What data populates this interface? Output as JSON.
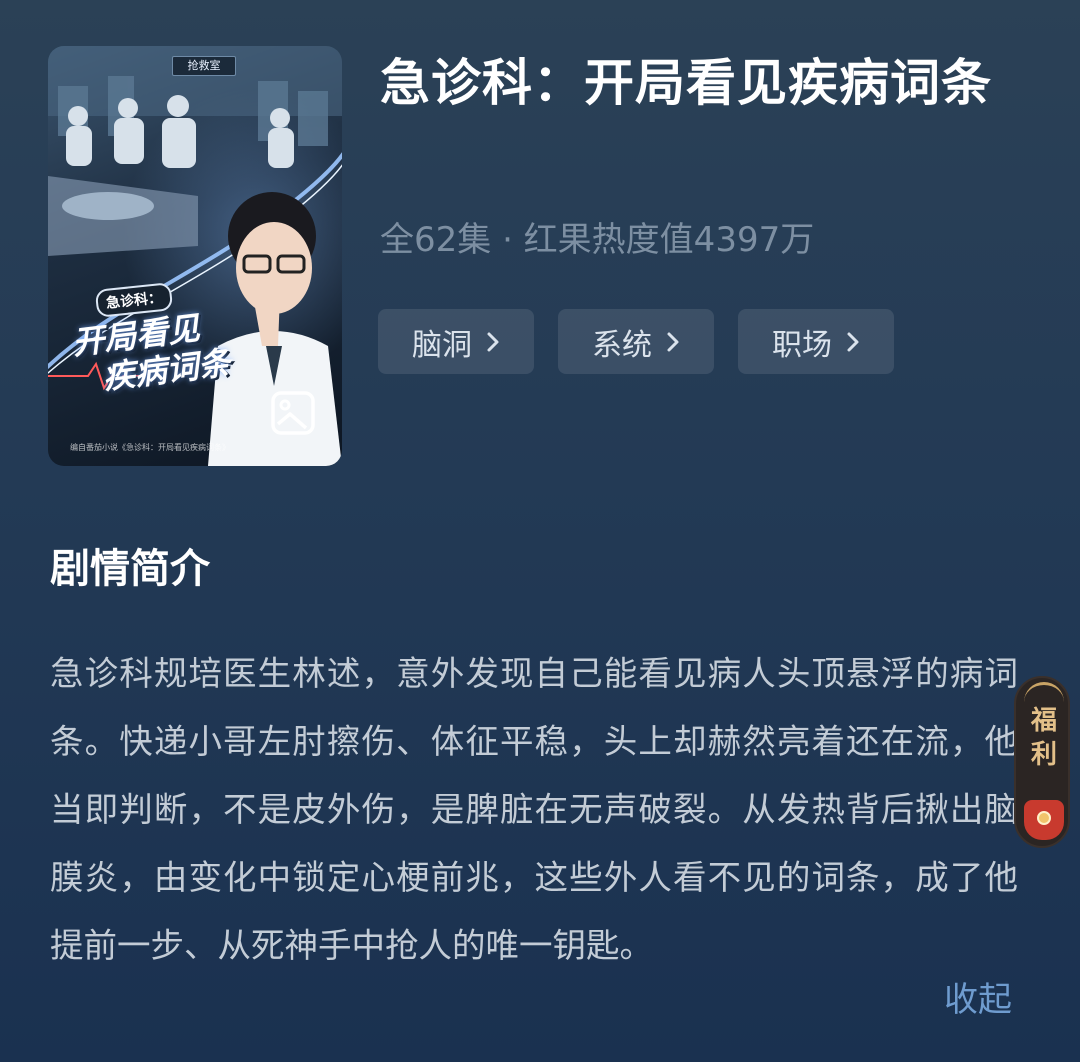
{
  "drama": {
    "title": "急诊科：开局看见疾病词条",
    "meta": "全62集 · 红果热度值4397万",
    "tags": [
      {
        "label": "脑洞"
      },
      {
        "label": "系统"
      },
      {
        "label": "职场"
      }
    ]
  },
  "poster": {
    "sign_text": "抢救室",
    "tag_text": "急诊科：",
    "calligraphy_line1": "开局看见",
    "calligraphy_line2": "疾病词条",
    "credit_text": "编自番茄小说《急诊科：开局看见疾病词条》",
    "badge_icon": "image-icon"
  },
  "synopsis": {
    "heading": "剧情简介",
    "text": "急诊科规培医生林述，意外发现自己能看见病人头顶悬浮的病词条。快递小哥左肘擦伤、体征平稳，头上却赫然亮着还在流，他当即判断，不是皮外伤，是脾脏在无声破裂。从发热背后揪出脑膜炎，由变化中锁定心梗前兆，这些外人看不见的词条，成了他提前一步、从死神手中抢人的唯一钥匙。",
    "collapse_label": "收起"
  },
  "welfare": {
    "char1": "福",
    "char2": "利"
  },
  "colors": {
    "background_top": "#2b4156",
    "background_bottom": "#1a3150",
    "meta_text": "#7d8fa2",
    "collapse_link": "#6f9ccf",
    "welfare_gold": "#e3c089",
    "welfare_red": "#c83a2e"
  }
}
